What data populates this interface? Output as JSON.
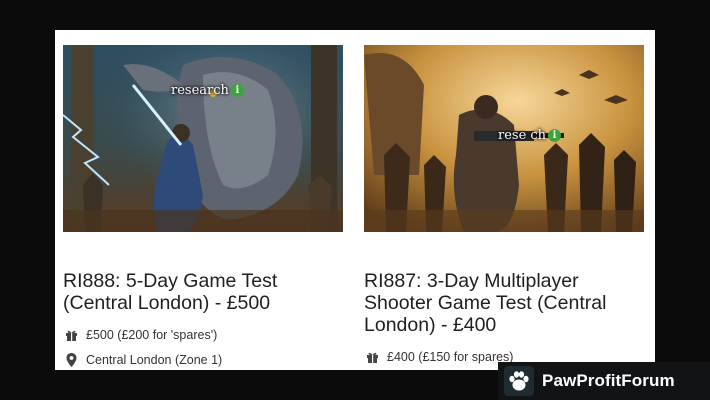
{
  "listings": [
    {
      "title": "RI888: 5-Day Game Test (Central London) - £500",
      "watermark": "research",
      "watermark_icon": "i",
      "reward": "£500 (£200 for 'spares')",
      "location": "Central London (Zone 1)",
      "image_icon": "fantasy-battle-image"
    },
    {
      "title": "RI887: 3-Day Multiplayer Shooter Game Test (Central London) - £400",
      "watermark": "rese  ch",
      "watermark_icon": "i",
      "reward": "£400 (£150 for spares)",
      "image_icon": "soldier-battle-image"
    }
  ],
  "brand": {
    "name": "PawProfitForum",
    "icon": "paw-icon"
  },
  "colors": {
    "background": "#0b0b0b",
    "panel": "#ffffff",
    "title": "#1f1f1f",
    "brand_bg": "#111315"
  }
}
